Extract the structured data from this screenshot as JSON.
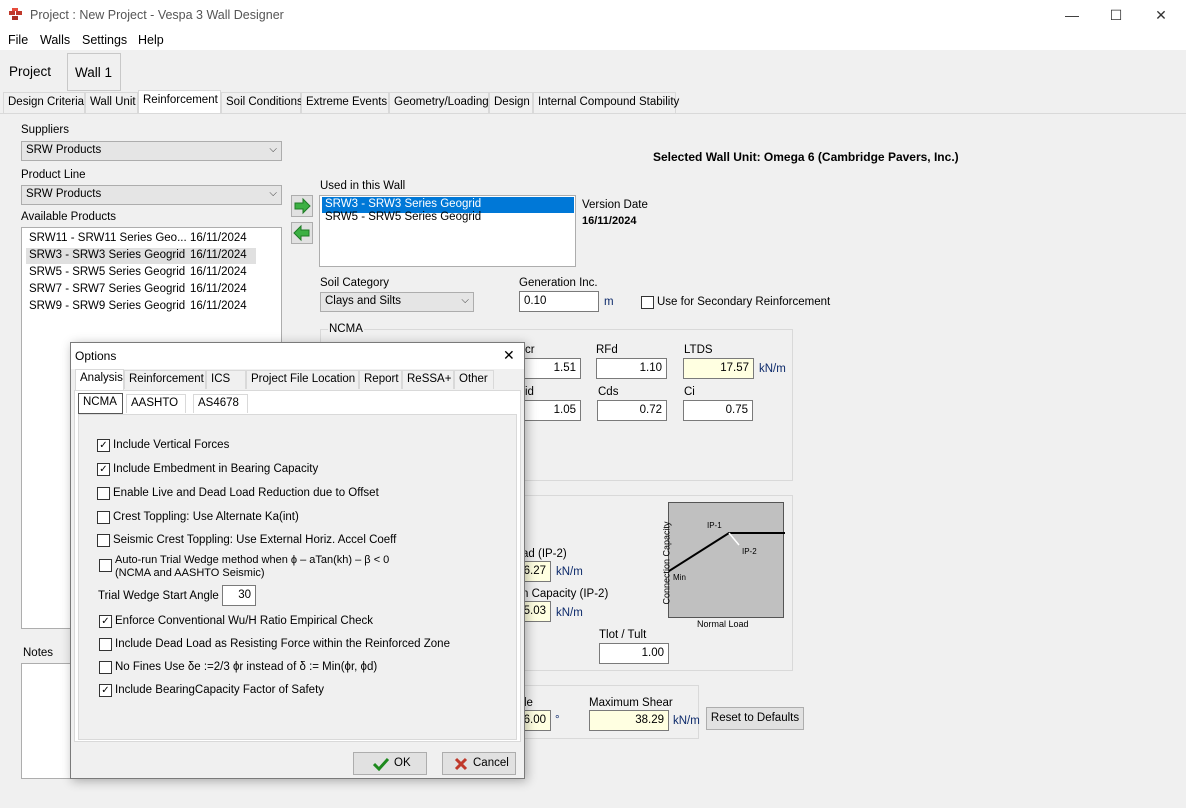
{
  "window": {
    "title": "Project : New Project - Vespa 3 Wall Designer",
    "minimize": "—",
    "maximize": "☐",
    "close": "✕"
  },
  "menu": [
    "File",
    "Walls",
    "Settings",
    "Help"
  ],
  "project_tabs": [
    "Project",
    "Wall 1"
  ],
  "tabs": [
    "Design Criteria",
    "Wall Unit",
    "Reinforcement",
    "Soil Conditions",
    "Extreme Events",
    "Geometry/Loading",
    "Design",
    "Internal Compound Stability"
  ],
  "left": {
    "suppliers_label": "Suppliers",
    "suppliers_value": "SRW Products",
    "product_line_label": "Product Line",
    "product_line_value": "SRW Products",
    "available_label": "Available Products",
    "available": [
      {
        "name": "SRW11 - SRW11 Series Geo...",
        "date": "16/11/2024"
      },
      {
        "name": "SRW3 - SRW3 Series Geogrid",
        "date": "16/11/2024"
      },
      {
        "name": "SRW5 - SRW5 Series Geogrid",
        "date": "16/11/2024"
      },
      {
        "name": "SRW7 - SRW7 Series Geogrid",
        "date": "16/11/2024"
      },
      {
        "name": "SRW9 - SRW9 Series Geogrid",
        "date": "16/11/2024"
      }
    ],
    "notes_label": "Notes"
  },
  "right": {
    "selected_unit": "Selected Wall Unit: Omega 6 (Cambridge Pavers, Inc.)",
    "used_label": "Used in this Wall",
    "used": [
      "SRW3 - SRW3 Series Geogrid",
      "SRW5 - SRW5 Series Geogrid"
    ],
    "version_date_label": "Version Date",
    "version_date": "16/11/2024",
    "soil_category_label": "Soil Category",
    "soil_category": "Clays and Silts",
    "generation_inc_label": "Generation Inc.",
    "generation_inc": "0.10",
    "generation_unit": "m",
    "secondary_label": "Use for Secondary Reinforcement",
    "ncma_label": "NCMA",
    "rfcr_label": "cr",
    "rfcr": "1.51",
    "rfd_label": "RFd",
    "rfd": "1.10",
    "ltds_label": "LTDS",
    "ltds": "17.57",
    "ltds_unit": "kN/m",
    "rfid_label": "id",
    "rfid": "1.05",
    "cds_label": "Cds",
    "cds": "0.72",
    "ci_label": "Ci",
    "ci": "0.75",
    "ip2_load_label": "ad (IP-2)",
    "ip2_load": "26.27",
    "ip2_load_unit": "kN/m",
    "ip2_cap_label": "n Capacity (IP-2)",
    "ip2_cap": "15.03",
    "ip2_cap_unit": "kN/m",
    "tlot_label": "Tlot / Tult",
    "tlot": "1.00",
    "angle_label": "le",
    "angle": "36.00",
    "angle_unit": "°",
    "max_shear_label": "Maximum Shear",
    "max_shear": "38.29",
    "max_shear_unit": "kN/m",
    "reset_button": "Reset to Defaults",
    "chart": {
      "ylabel": "Connection Capacity",
      "xlabel": "Normal Load",
      "ip1": "IP-1",
      "ip2": "IP-2",
      "min": "Min"
    }
  },
  "dialog": {
    "title": "Options",
    "close": "✕",
    "tabs": [
      "Analysis",
      "Reinforcement",
      "ICS",
      "Project File Location",
      "Report",
      "ReSSA+",
      "Other"
    ],
    "subtabs": [
      "NCMA",
      "AASHTO",
      "AS4678"
    ],
    "options": [
      {
        "label": "Include Vertical Forces",
        "checked": true
      },
      {
        "label": "Include Embedment in Bearing Capacity",
        "checked": true
      },
      {
        "label": "Enable Live and Dead Load Reduction due to Offset",
        "checked": false
      },
      {
        "label": "Crest Toppling: Use Alternate Ka(int)",
        "checked": false
      },
      {
        "label": "Seismic Crest Toppling: Use External Horiz. Accel Coeff",
        "checked": false
      }
    ],
    "autorun_line1": "Auto-run Trial Wedge method when  ϕ – aTan(kh) – β < 0",
    "autorun_line2": "(NCMA and AASHTO Seismic)",
    "trial_wedge_label": "Trial Wedge Start Angle",
    "trial_wedge_value": "30",
    "options2": [
      {
        "label": "Enforce Conventional Wu/H Ratio Empirical Check",
        "checked": true
      },
      {
        "label": "Include Dead Load as Resisting Force within the Reinforced Zone",
        "checked": false
      },
      {
        "label": "No Fines Use δe :=2/3 ϕr instead of δ := Min(ϕr, ϕd)",
        "checked": false
      },
      {
        "label": "Include BearingCapacity Factor of Safety",
        "checked": true
      }
    ],
    "ok": "OK",
    "cancel": "Cancel",
    "check_mark": "✓"
  }
}
